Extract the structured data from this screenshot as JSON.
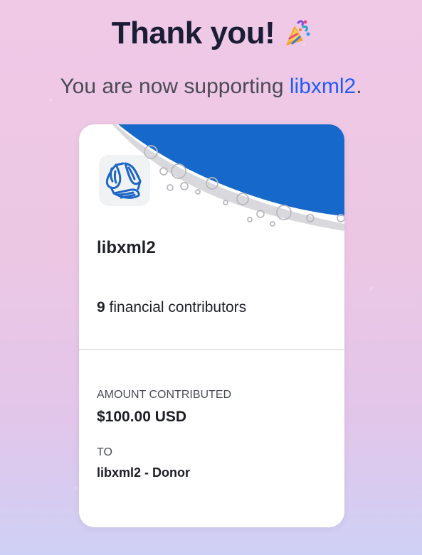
{
  "header": {
    "title": "Thank you!",
    "title_emoji": "party-popper-icon"
  },
  "subtitle": {
    "prefix": "You are now supporting ",
    "link_text": "libxml2",
    "suffix": "."
  },
  "card": {
    "logo_icon": "libxml2-logo-icon",
    "collective_name": "libxml2",
    "contributors_count": "9",
    "contributors_label": " financial contributors",
    "amount_label": "AMOUNT CONTRIBUTED",
    "amount_value": "$100.00 USD",
    "to_label": "TO",
    "to_value": "libxml2 - Donor"
  },
  "colors": {
    "title": "#1b1d35",
    "link": "#1f5bff",
    "card_accent": "#1668ca"
  }
}
